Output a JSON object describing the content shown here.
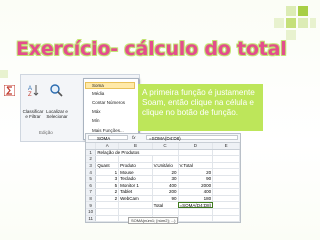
{
  "slide": {
    "title": "Exercício- cálculo do total",
    "callout_text": "A primeira função é justamente Soam, então clique na célula e clique no botão de função.",
    "accent_color": "#e44d8d",
    "callout_color": "#bde65a"
  },
  "ribbon": {
    "sum_icon": "sigma-icon",
    "buttons": [
      {
        "label": "Classificar e Filtrar",
        "icon": "sort-filter-icon"
      },
      {
        "label": "Localizar e Selecionar",
        "icon": "find-select-icon"
      }
    ],
    "group_label": "Edição",
    "dropdown_items": [
      "Soma",
      "Média",
      "Contar Números",
      "Máx",
      "Mín",
      "Mais Funções..."
    ],
    "dropdown_selected": "Soma"
  },
  "spreadsheet": {
    "name_box": "SOMA",
    "fx_label": "fx",
    "formula": "=SOMA(D4:D8)",
    "column_headers": [
      "A",
      "B",
      "C",
      "D",
      "E"
    ],
    "rows": [
      {
        "num": "1",
        "cells": [
          "Relação de Produtos",
          "",
          "",
          "",
          ""
        ]
      },
      {
        "num": "2",
        "cells": [
          "",
          "",
          "",
          "",
          ""
        ]
      },
      {
        "num": "3",
        "cells": [
          "Quant",
          "Produto",
          "V.Unitário",
          "V.Total",
          ""
        ]
      },
      {
        "num": "4",
        "cells": [
          "1",
          "Mouse",
          "20",
          "20",
          ""
        ]
      },
      {
        "num": "5",
        "cells": [
          "3",
          "Teclado",
          "30",
          "90",
          ""
        ]
      },
      {
        "num": "6",
        "cells": [
          "5",
          "Monitor 1",
          "400",
          "2000",
          ""
        ]
      },
      {
        "num": "7",
        "cells": [
          "2",
          "Tablet",
          "200",
          "400",
          ""
        ]
      },
      {
        "num": "8",
        "cells": [
          "2",
          "WebCam",
          "90",
          "180",
          ""
        ]
      },
      {
        "num": "9",
        "cells": [
          "",
          "",
          "Total",
          "=SOMA(D4:D8)",
          ""
        ]
      },
      {
        "num": "10",
        "cells": [
          "",
          "",
          "",
          "",
          ""
        ]
      },
      {
        "num": "11",
        "cells": [
          "",
          "",
          "",
          "",
          ""
        ]
      },
      {
        "num": "12",
        "cells": [
          "",
          "",
          "",
          "",
          ""
        ]
      }
    ],
    "tooltip": "SOMA(núm1; [núm2]; ...)"
  }
}
